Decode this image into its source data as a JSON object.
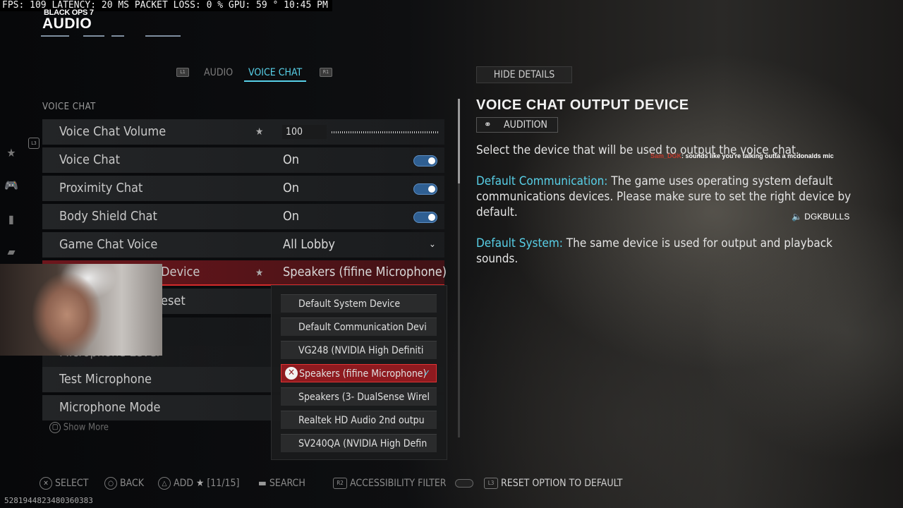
{
  "overlay": {
    "perf_text": "FPS: 109 LATENCY: 20 MS PACKET LOSS: 0 % GPU: 59 ° 10:45 PM"
  },
  "brand": {
    "game": "BLACK OPS 7",
    "page_title": "AUDIO"
  },
  "tabs": {
    "left_button": "L1",
    "items": [
      "AUDIO",
      "VOICE CHAT"
    ],
    "active": "VOICE CHAT",
    "right_button": "R1"
  },
  "section": {
    "title": "VOICE CHAT",
    "l3_badge": "L3"
  },
  "settings": [
    {
      "label": "Voice Chat Volume",
      "value": "100",
      "type": "slider",
      "slider_fill": 1.0,
      "starred": true
    },
    {
      "label": "Voice Chat",
      "value": "On",
      "type": "toggle"
    },
    {
      "label": "Proximity Chat",
      "value": "On",
      "type": "toggle"
    },
    {
      "label": "Body Shield Chat",
      "value": "On",
      "type": "toggle"
    },
    {
      "label": "Game Chat Voice",
      "value": "All Lobby",
      "type": "dropdown"
    },
    {
      "label": "Device",
      "value": "Speakers (fifine Microphone)",
      "type": "dropdown-open",
      "starred": true
    },
    {
      "label": "eset",
      "value": "",
      "type": "partial"
    },
    {
      "label": "Microphone Level",
      "value": "",
      "type": "obscured"
    },
    {
      "label": "Test Microphone",
      "value": "",
      "type": "plain"
    },
    {
      "label": "Microphone Mode",
      "value": "",
      "type": "plain"
    }
  ],
  "dropdown": {
    "options": [
      "Default System Device",
      "Default Communication Devi",
      "VG248 (NVIDIA High Definiti",
      "Speakers (fifine Microphone)",
      "Speakers (3- DualSense Wirel",
      "Realtek HD Audio 2nd outpu",
      "SV240QA (NVIDIA High Defin"
    ],
    "selected_index": 3,
    "check_glyph": "✓",
    "cancel_glyph": "✕"
  },
  "show_more": {
    "label": "Show More"
  },
  "details": {
    "hide_button": "HIDE DETAILS",
    "title": "VOICE CHAT OUTPUT DEVICE",
    "audition_label": "AUDITION",
    "description": "Select the device that will be used to output the voice chat.",
    "default_comm_label": "Default Communication:",
    "default_comm_text": " The game uses operating system default communications devices. Please make sure to set the right device by default.",
    "default_system_label": "Default System:",
    "default_system_text": " The same device is used for output and playback sounds."
  },
  "stream_overlay": {
    "chat_user": "Sam_DGK",
    "chat_message": ": sounds like you're talking outta a mcdonalds mic",
    "speaker_name": "DGKBULLS"
  },
  "footer": {
    "select": "SELECT",
    "back": "BACK",
    "add": "ADD",
    "favorites_count": "[11/15]",
    "search": "SEARCH",
    "accessibility": "ACCESSIBILITY FILTER",
    "reset": "RESET OPTION TO DEFAULT",
    "r2_badge": "R2",
    "l3_badge": "L3"
  },
  "session_id": "5281944823480360383",
  "colors": {
    "accent": "#58d0e8",
    "selected_red": "#d22a2a",
    "toggle_blue": "#2f5f92"
  },
  "icons": [
    "star-icon",
    "controller-icon",
    "mouse-icon",
    "keyboard-icon",
    "ear-icon",
    "speaker-icon",
    "trash-icon"
  ]
}
